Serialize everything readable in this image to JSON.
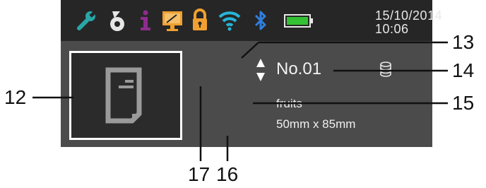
{
  "status_bar": {
    "icons": [
      {
        "name": "wrench-icon",
        "color": "#2aa6a6"
      },
      {
        "name": "ink-drop-icon",
        "color": "#e6e6e6"
      },
      {
        "name": "info-icon",
        "color": "#8e2c8e"
      },
      {
        "name": "monitor-icon",
        "color": "#f0a030"
      },
      {
        "name": "lock-icon",
        "color": "#f0a030"
      },
      {
        "name": "wifi-icon",
        "color": "#26b5d9"
      },
      {
        "name": "bluetooth-icon",
        "color": "#2f7fe0"
      },
      {
        "name": "battery-icon",
        "color": "#34c134"
      }
    ],
    "date": "15/10/2014",
    "time": "10:06"
  },
  "template": {
    "number": "No.01",
    "name": "fruits",
    "size": "50mm x 85mm",
    "thumbnail_icon": "document-icon",
    "storage_icon": "database-icon",
    "selector_icon": "up-down-arrows-icon"
  },
  "callouts": {
    "c12": "12",
    "c13": "13",
    "c14": "14",
    "c15": "15",
    "c16": "16",
    "c17": "17"
  },
  "colors": {
    "screen_bg": "#4b4b4b",
    "status_bg": "#262626",
    "text": "#f0f0f0",
    "thumb_bg": "#2b2b2b"
  }
}
